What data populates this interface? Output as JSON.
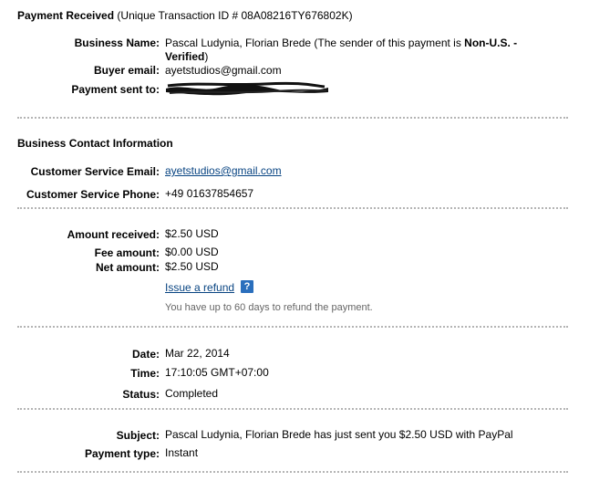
{
  "header": {
    "title": "Payment Received",
    "transaction": "(Unique Transaction ID # 08A08216TY676802K)"
  },
  "sender": {
    "business_name_label": "Business Name:",
    "business_name_value": "Pascal Ludynia, Florian Brede (The sender of this payment is ",
    "status_bold": "Non-U.S. -",
    "status_bold_2": "Verified",
    "status_tail": ")",
    "buyer_email_label": "Buyer email:",
    "buyer_email_value": "ayetstudios@gmail.com",
    "payment_sent_label": "Payment sent to:"
  },
  "business_contact": {
    "heading": "Business Contact Information",
    "email_label": "Customer Service Email:",
    "email_value": "ayetstudios@gmail.com",
    "phone_label": "Customer Service Phone:",
    "phone_value": "+49 01637854657"
  },
  "amounts": {
    "received_label": "Amount received:",
    "received_value": "$2.50 USD",
    "fee_label": "Fee amount:",
    "fee_value": "$0.00 USD",
    "net_label": "Net amount:",
    "net_value": "$2.50 USD",
    "refund_link": "Issue a refund",
    "help_glyph": "?",
    "refund_note": "You have up to 60 days to refund the payment."
  },
  "timing": {
    "date_label": "Date:",
    "date_value": "Mar 22, 2014",
    "time_label": "Time:",
    "time_value": "17:10:05 GMT+07:00",
    "status_label": "Status:",
    "status_value": "Completed"
  },
  "details": {
    "subject_label": "Subject:",
    "subject_value": "Pascal Ludynia, Florian Brede has just sent you $2.50 USD with PayPal",
    "payment_type_label": "Payment type:",
    "payment_type_value": "Instant"
  },
  "colors": {
    "link": "#084482",
    "separator": "#b4b4b4",
    "help_icon": "#2a6fbd",
    "note_text": "#666666"
  }
}
